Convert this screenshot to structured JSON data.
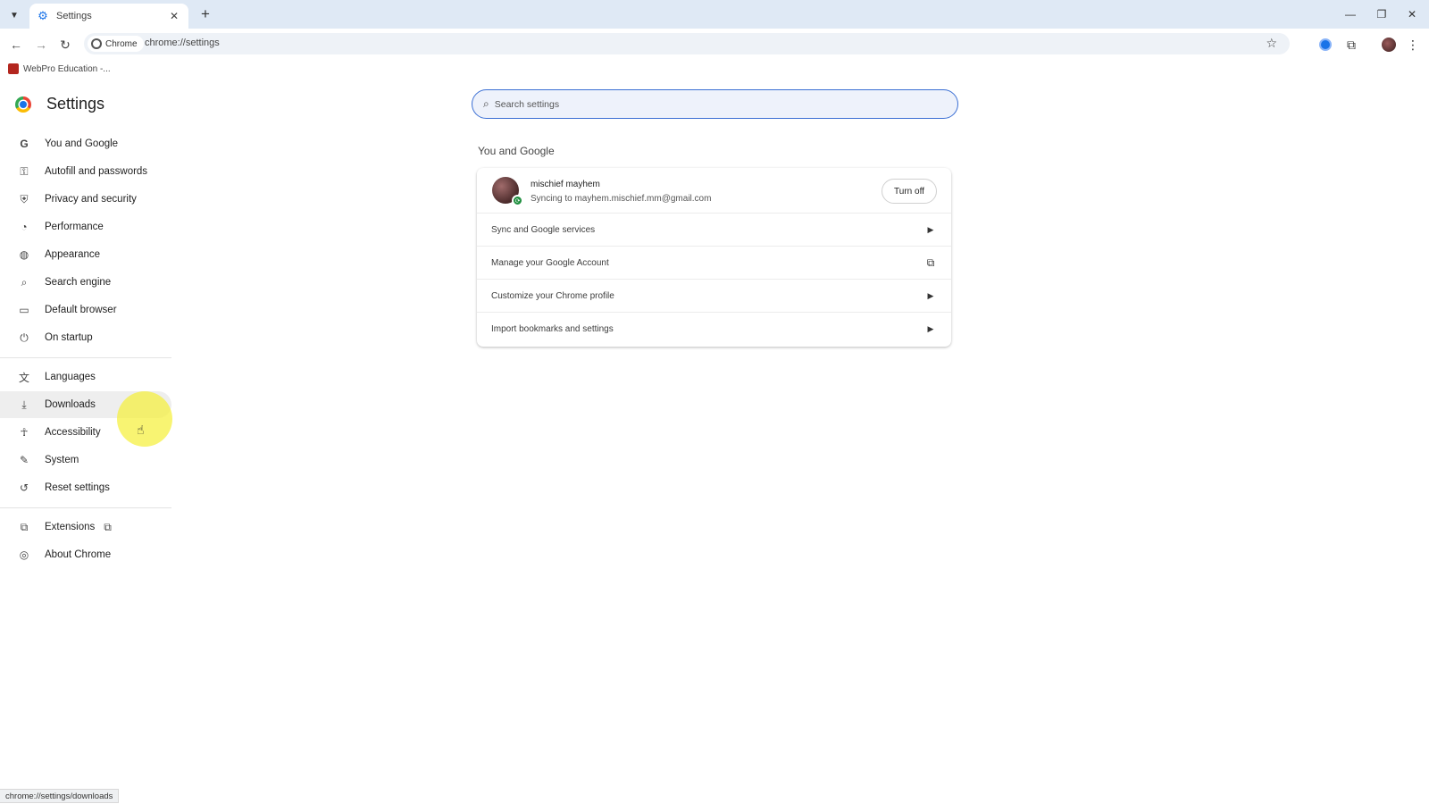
{
  "browser": {
    "tab": {
      "title": "Settings",
      "icon": "gear-icon"
    },
    "chip_label": "Chrome",
    "url": "chrome://settings",
    "bookmark": {
      "label": "WebPro Education -..."
    },
    "status_url": "chrome://settings/downloads"
  },
  "settings": {
    "title": "Settings",
    "search_placeholder": "Search settings",
    "nav": [
      {
        "label": "You and Google",
        "icon": "google-g-icon"
      },
      {
        "label": "Autofill and passwords",
        "icon": "key-icon"
      },
      {
        "label": "Privacy and security",
        "icon": "shield-icon"
      },
      {
        "label": "Performance",
        "icon": "speedometer-icon"
      },
      {
        "label": "Appearance",
        "icon": "palette-icon"
      },
      {
        "label": "Search engine",
        "icon": "search-icon"
      },
      {
        "label": "Default browser",
        "icon": "browser-window-icon"
      },
      {
        "label": "On startup",
        "icon": "power-icon"
      },
      {
        "label": "Languages",
        "icon": "translate-icon"
      },
      {
        "label": "Downloads",
        "icon": "download-icon"
      },
      {
        "label": "Accessibility",
        "icon": "accessibility-icon"
      },
      {
        "label": "System",
        "icon": "wrench-icon"
      },
      {
        "label": "Reset settings",
        "icon": "reset-icon"
      },
      {
        "label": "Extensions",
        "icon": "puzzle-icon"
      },
      {
        "label": "About Chrome",
        "icon": "chrome-icon"
      }
    ],
    "section_title": "You and Google",
    "account": {
      "name": "mischief mayhem",
      "sync_text": "Syncing to mayhem.mischief.mm@gmail.com",
      "turn_off_label": "Turn off"
    },
    "rows": [
      {
        "label": "Sync and Google services",
        "icon": "chevron-right-icon"
      },
      {
        "label": "Manage your Google Account",
        "icon": "open-in-new-icon"
      },
      {
        "label": "Customize your Chrome profile",
        "icon": "chevron-right-icon"
      },
      {
        "label": "Import bookmarks and settings",
        "icon": "chevron-right-icon"
      }
    ]
  },
  "colors": {
    "accent": "#1a73e8",
    "highlight": "#f5f03c",
    "tabstrip": "#dfe9f5"
  }
}
